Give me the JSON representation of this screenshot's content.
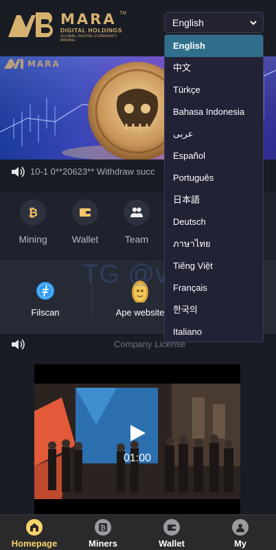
{
  "header": {
    "brand_name": "MARA",
    "brand_tm": "TM",
    "brand_sub": "DIGITAL HOLDINGS",
    "brand_tagline": "GLOBAL DIGITAL CURRENCY MINING",
    "language_selected": "English"
  },
  "language_options": [
    "English",
    "中文",
    "Türkçe",
    "Bahasa Indonesia",
    "عربى",
    "Español",
    "Português",
    "日本語",
    "Deutsch",
    "ภาษาไทย",
    "Tiếng Việt",
    "Français",
    "한국의",
    "Italiano"
  ],
  "notice": {
    "text": "10-1 0**20623** Withdraw succ"
  },
  "quick_menu": [
    {
      "label": "Mining",
      "icon": "bitcoin-icon"
    },
    {
      "label": "Wallet",
      "icon": "wallet-icon"
    },
    {
      "label": "Team",
      "icon": "team-icon"
    }
  ],
  "watermark": "TG @vc099",
  "links": [
    {
      "label": "Filscan",
      "icon": "filecoin-icon"
    },
    {
      "label": "Ape website",
      "icon": "ape-coin-icon"
    }
  ],
  "license": {
    "text": "Company License"
  },
  "video": {
    "duration": "01:00"
  },
  "bottom_nav": [
    {
      "label": "Homepage",
      "icon": "home-icon",
      "active": true
    },
    {
      "label": "Miners",
      "icon": "miner-icon",
      "active": false
    },
    {
      "label": "Wallet",
      "icon": "wallet-icon",
      "active": false
    },
    {
      "label": "My",
      "icon": "user-icon",
      "active": false
    }
  ],
  "colors": {
    "gold": "#d6b16f",
    "accent": "#f7d36b",
    "selected_option": "#2f6f8c",
    "background": "#191c25"
  }
}
